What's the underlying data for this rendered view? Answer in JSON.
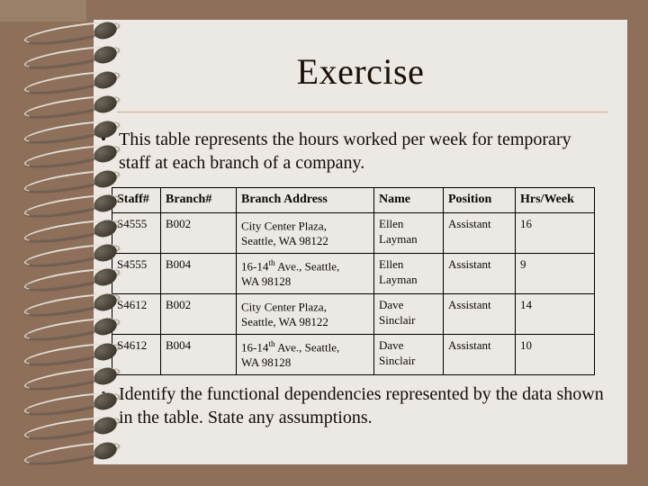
{
  "slide": {
    "title": "Exercise",
    "bullet_glyph": "•",
    "bullets": [
      "This table represents the hours worked per week for temporary staff at each branch of a company.",
      "Identify the functional dependencies represented by the data shown in the table.  State any assumptions."
    ]
  },
  "colors": {
    "background": "#8e6f5a",
    "background_patch": "#9b8069",
    "page": "#ece8e4",
    "title_text": "#1a1008",
    "rule": "#c3ae8a",
    "body_text": "#120c06",
    "table_border": "#000000"
  },
  "table": {
    "headers": [
      "Staff#",
      "Branch#",
      "Branch Address",
      "Name",
      "Position",
      "Hrs/Week"
    ],
    "rows": [
      {
        "staff": "S4555",
        "branch": "B002",
        "address_line1": "City Center Plaza,",
        "address_line2": "Seattle, WA 98122",
        "address_sup": "",
        "name_line1": "Ellen",
        "name_line2": "Layman",
        "position": "Assistant",
        "hrs": "16"
      },
      {
        "staff": "S4555",
        "branch": "B004",
        "address_line1": "16-14",
        "address_sup": "th",
        "address_line1b": " Ave., Seattle,",
        "address_line2": "WA 98128",
        "name_line1": "Ellen",
        "name_line2": "Layman",
        "position": "Assistant",
        "hrs": "9"
      },
      {
        "staff": "S4612",
        "branch": "B002",
        "address_line1": "City Center Plaza,",
        "address_line2": "Seattle, WA 98122",
        "address_sup": "",
        "name_line1": "Dave",
        "name_line2": "Sinclair",
        "position": "Assistant",
        "hrs": "14"
      },
      {
        "staff": "S4612",
        "branch": "B004",
        "address_line1": "16-14",
        "address_sup": "th",
        "address_line1b": " Ave., Seattle,",
        "address_line2": "WA 98128",
        "name_line1": "Dave",
        "name_line2": "Sinclair",
        "position": "Assistant",
        "hrs": "10"
      }
    ]
  },
  "decoration": {
    "spiral_ring_count": 18
  }
}
